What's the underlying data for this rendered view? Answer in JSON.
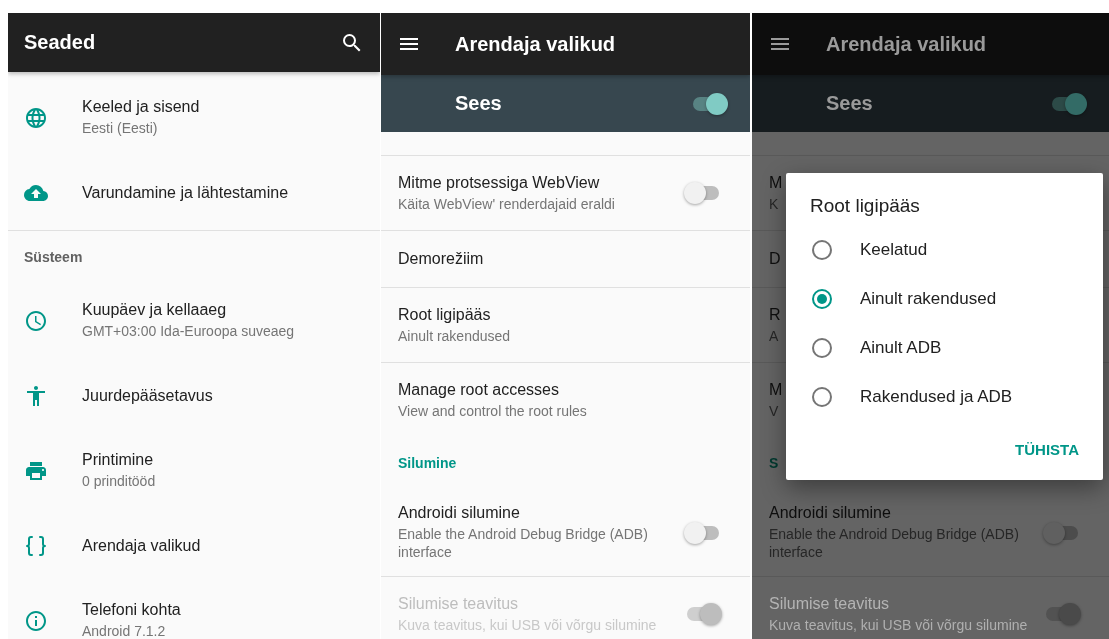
{
  "panels": [
    {
      "kind": "settings",
      "title": "Seaded",
      "rows": [
        {
          "kind": "item",
          "title": "Keeled ja sisend",
          "subtitle": "Eesti (Eesti)"
        },
        {
          "kind": "item",
          "title": "Varundamine ja lähtestamine"
        },
        {
          "kind": "header",
          "label": "Süsteem"
        },
        {
          "kind": "item",
          "title": "Kuupäev ja kellaaeg",
          "subtitle": "GMT+03:00 Ida-Euroopa suveaeg"
        },
        {
          "kind": "item",
          "title": "Juurdepääsetavus"
        },
        {
          "kind": "item",
          "title": "Printimine",
          "subtitle": "0 prinditööd"
        },
        {
          "kind": "item",
          "title": "Arendaja valikud"
        },
        {
          "kind": "item",
          "title": "Telefoni kohta",
          "subtitle": "Android 7.1.2"
        }
      ]
    },
    {
      "kind": "developer",
      "title": "Arendaja valikud",
      "master": {
        "label": "Sees",
        "on": true
      },
      "rows": [
        {
          "kind": "item",
          "title": "Mitme protsessiga WebView",
          "subtitle": "Käita WebView' renderdajaid eraldi",
          "on": false,
          "disabled": false
        },
        {
          "kind": "item",
          "title": "Demorežiim"
        },
        {
          "kind": "item",
          "title": "Root ligipääs",
          "subtitle": "Ainult rakendused"
        },
        {
          "kind": "item",
          "title": "Manage root accesses",
          "subtitle": "View and control the root rules"
        },
        {
          "kind": "header",
          "label": "Silumine"
        },
        {
          "kind": "item",
          "title": "Androidi silumine",
          "subtitle": "Enable the Android Debug Bridge (ADB) interface",
          "on": false,
          "disabled": false
        },
        {
          "kind": "item",
          "title": "Silumise teavitus",
          "subtitle": "Kuva teavitus, kui USB või võrgu silumine",
          "on": true,
          "disabled": true
        }
      ]
    },
    {
      "kind": "developer",
      "title": "Arendaja valikud",
      "master": {
        "label": "Sees",
        "on": true
      },
      "rows": [
        {
          "kind": "item",
          "title": "M",
          "subtitle": "K"
        },
        {
          "kind": "item",
          "title": "D"
        },
        {
          "kind": "item",
          "title": "R",
          "subtitle": "A"
        },
        {
          "kind": "item",
          "title": "M",
          "subtitle": "V"
        },
        {
          "kind": "header",
          "label": "S"
        },
        {
          "kind": "item",
          "title": "Androidi silumine",
          "subtitle": "Enable the Android Debug Bridge (ADB) interface",
          "on": false,
          "disabled": false
        },
        {
          "kind": "item",
          "title": "Silumise teavitus",
          "subtitle": "Kuva teavitus, kui USB või võrgu silumine",
          "on": true,
          "disabled": true
        }
      ],
      "dialog": {
        "title": "Root ligipääs",
        "options": [
          {
            "label": "Keelatud",
            "selected": false
          },
          {
            "label": "Ainult rakendused",
            "selected": true
          },
          {
            "label": "Ainult ADB",
            "selected": false
          },
          {
            "label": "Rakendused ja ADB",
            "selected": false
          }
        ],
        "action": "TÜHISTA"
      }
    }
  ]
}
